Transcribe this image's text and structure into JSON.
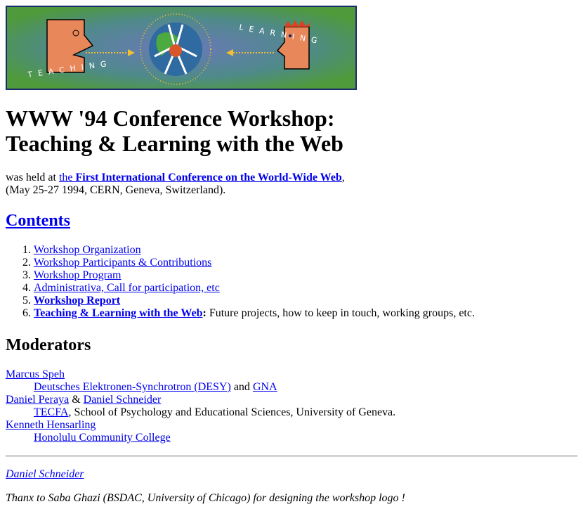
{
  "banner": {
    "logo_text_left": "TEACHING",
    "logo_text_right": "LEARNING",
    "logo_text_globe": "world wide web",
    "colors": {
      "background": "#4a9a3a",
      "center": "#5a7ab0",
      "face": "#e8875a",
      "border": "#1b2a6b"
    }
  },
  "title": {
    "line1": "WWW '94 Conference Workshop:",
    "line2": "Teaching & Learning with the Web"
  },
  "intro": {
    "prefix": "was held at ",
    "link_the": "the ",
    "link_bold": "First International Conference on the World-Wide Web",
    "suffix": ",",
    "line2": "(May 25-27 1994, CERN, Geneva, Switzerland)."
  },
  "contents": {
    "heading": "Contents",
    "items": [
      {
        "label": "Workshop Organization"
      },
      {
        "label": "Workshop Participants & Contributions"
      },
      {
        "label": "Workshop Program"
      },
      {
        "label": "Administrativa, Call for participation, etc"
      },
      {
        "label": "Workshop Report"
      },
      {
        "label": "Teaching & Learning with the Web",
        "colon": ":",
        "desc": " Future projects, how to keep in touch, working groups, etc."
      }
    ]
  },
  "moderators": {
    "heading": "Moderators",
    "m1": {
      "name": "Marcus Speh",
      "org1": "Deutsches Elektronen-Synchrotron (DESY)",
      "and": " and ",
      "org2": "GNA"
    },
    "m2": {
      "name1": "Daniel Peraya",
      "amp": " & ",
      "name2": "Daniel Schneider",
      "org": "TECFA",
      "org_rest": ", School of Psychology and Educational Sciences, University of Geneva."
    },
    "m3": {
      "name": "Kenneth Hensarling",
      "org": "Honolulu Community College"
    }
  },
  "footer": {
    "author": "Daniel Schneider",
    "thanks": "Thanx to Saba Ghazi (BSDAC, University of Chicago) for designing the workshop logo !"
  }
}
